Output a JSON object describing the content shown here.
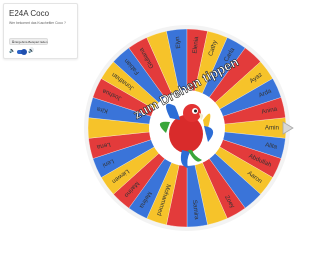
{
  "card": {
    "title": "E24A Coco",
    "subtitle": "Wer bekommt das Kuscheltier Coco ?",
    "sample_button": "Ergebnis-Beispiel: Eden",
    "sample_button_icon": "copy-icon",
    "sound_icon_left": "speaker-low-icon",
    "sound_icon_right": "speaker-high-icon"
  },
  "wheel": {
    "center_text": "zum Drehen tippen",
    "center_image": "red parrot illustration",
    "pointer_icon": "triangle-pointer-icon",
    "colors": {
      "red": "#e33b3b",
      "yellow": "#f6c32a",
      "blue": "#3a74d9",
      "center": "#ffffff",
      "rim": "#f3f3f3"
    },
    "segments": [
      {
        "name": "Amin",
        "color": "#f6c32a"
      },
      {
        "name": "Alita",
        "color": "#3a74d9"
      },
      {
        "name": "Abdullah",
        "color": "#e33b3b"
      },
      {
        "name": "Aaron",
        "color": "#f6c32a"
      },
      {
        "name": "",
        "color": "#3a74d9"
      },
      {
        "name": "Zoey",
        "color": "#e33b3b"
      },
      {
        "name": "",
        "color": "#f6c32a"
      },
      {
        "name": "Samira",
        "color": "#3a74d9"
      },
      {
        "name": "",
        "color": "#e33b3b"
      },
      {
        "name": "Mohammed",
        "color": "#f6c32a"
      },
      {
        "name": "Melina",
        "color": "#3a74d9"
      },
      {
        "name": "Marino",
        "color": "#e33b3b"
      },
      {
        "name": "Liewen",
        "color": "#f6c32a"
      },
      {
        "name": "Leni",
        "color": "#3a74d9"
      },
      {
        "name": "Lena",
        "color": "#e33b3b"
      },
      {
        "name": "",
        "color": "#f6c32a"
      },
      {
        "name": "Kira",
        "color": "#3a74d9"
      },
      {
        "name": "Joshua",
        "color": "#e33b3b"
      },
      {
        "name": "Jonathan",
        "color": "#f6c32a"
      },
      {
        "name": "Fabian",
        "color": "#3a74d9"
      },
      {
        "name": "Giuliana",
        "color": "#e33b3b"
      },
      {
        "name": "",
        "color": "#f6c32a"
      },
      {
        "name": "Elyn",
        "color": "#3a74d9"
      },
      {
        "name": "Elenia",
        "color": "#e33b3b"
      },
      {
        "name": "Cathy",
        "color": "#f6c32a"
      },
      {
        "name": "Carla",
        "color": "#3a74d9"
      },
      {
        "name": "",
        "color": "#e33b3b"
      },
      {
        "name": "Ayaz",
        "color": "#f6c32a"
      },
      {
        "name": "Arda",
        "color": "#3a74d9"
      },
      {
        "name": "Anina",
        "color": "#e33b3b"
      }
    ]
  }
}
